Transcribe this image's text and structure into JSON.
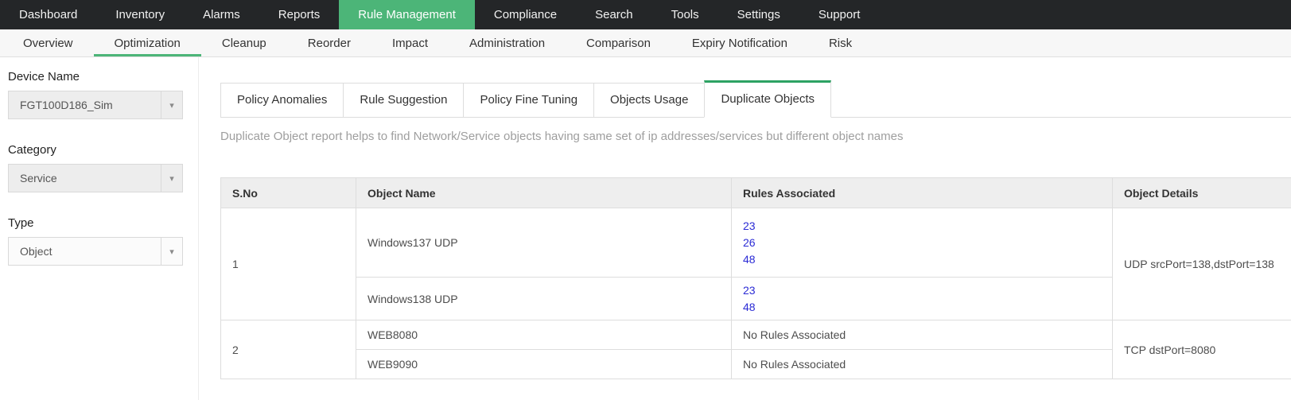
{
  "colors": {
    "topnav_bg": "#242628",
    "accent_green": "#4cb578",
    "tab_active_green": "#2da263",
    "link_blue": "#2b2bd5",
    "header_bg": "#eeeeee",
    "border": "#dddddd"
  },
  "topnav": {
    "items": [
      {
        "label": "Dashboard",
        "active": false
      },
      {
        "label": "Inventory",
        "active": false
      },
      {
        "label": "Alarms",
        "active": false
      },
      {
        "label": "Reports",
        "active": false
      },
      {
        "label": "Rule Management",
        "active": true
      },
      {
        "label": "Compliance",
        "active": false
      },
      {
        "label": "Search",
        "active": false
      },
      {
        "label": "Tools",
        "active": false
      },
      {
        "label": "Settings",
        "active": false
      },
      {
        "label": "Support",
        "active": false
      }
    ]
  },
  "subnav": {
    "items": [
      {
        "label": "Overview",
        "active": false
      },
      {
        "label": "Optimization",
        "active": true
      },
      {
        "label": "Cleanup",
        "active": false
      },
      {
        "label": "Reorder",
        "active": false
      },
      {
        "label": "Impact",
        "active": false
      },
      {
        "label": "Administration",
        "active": false
      },
      {
        "label": "Comparison",
        "active": false
      },
      {
        "label": "Expiry Notification",
        "active": false
      },
      {
        "label": "Risk",
        "active": false
      }
    ]
  },
  "sidebar": {
    "filters": [
      {
        "label": "Device Name",
        "value": "FGT100D186_Sim"
      },
      {
        "label": "Category",
        "value": "Service"
      },
      {
        "label": "Type",
        "value": "Object"
      }
    ]
  },
  "main": {
    "tabs": [
      {
        "label": "Policy Anomalies",
        "active": false
      },
      {
        "label": "Rule Suggestion",
        "active": false
      },
      {
        "label": "Policy Fine Tuning",
        "active": false
      },
      {
        "label": "Objects Usage",
        "active": false
      },
      {
        "label": "Duplicate Objects",
        "active": true
      }
    ],
    "description": "Duplicate Object report helps to find Network/Service objects having same set of ip addresses/services but different object names",
    "table": {
      "headers": [
        "S.No",
        "Object Name",
        "Rules Associated",
        "Object Details"
      ],
      "groups": [
        {
          "sno": "1",
          "details": "UDP srcPort=138,dstPort=138",
          "rows": [
            {
              "object_name": "Windows137 UDP",
              "rules": [
                "23",
                "26",
                "48"
              ]
            },
            {
              "object_name": "Windows138 UDP",
              "rules": [
                "23",
                "48"
              ]
            }
          ]
        },
        {
          "sno": "2",
          "details": "TCP dstPort=8080",
          "rows": [
            {
              "object_name": "WEB8080",
              "rules_text": "No Rules Associated"
            },
            {
              "object_name": "WEB9090",
              "rules_text": "No Rules Associated"
            }
          ]
        }
      ]
    }
  }
}
